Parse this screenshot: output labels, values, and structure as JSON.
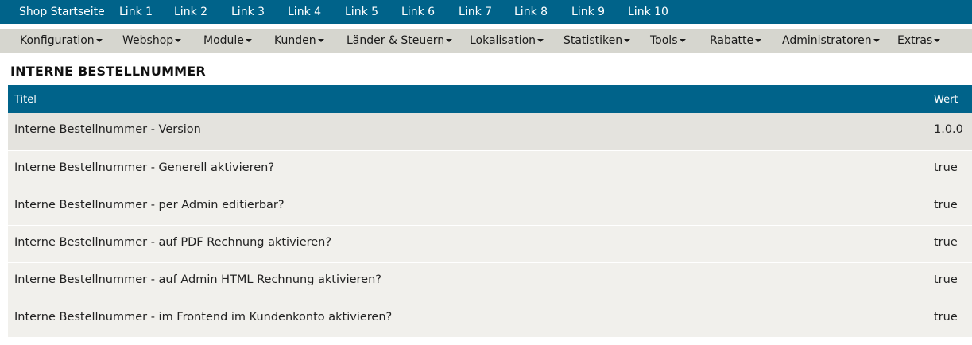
{
  "topnav": {
    "links": [
      "Shop Startseite",
      "Link 1",
      "Link 2",
      "Link 3",
      "Link 4",
      "Link 5",
      "Link 6",
      "Link 7",
      "Link 8",
      "Link 9",
      "Link 10"
    ]
  },
  "menu": {
    "items": [
      "Konfiguration",
      "Webshop",
      "Module",
      "Kunden",
      "Länder & Steuern",
      "Lokalisation",
      "Statistiken",
      "Tools",
      "Rabatte",
      "Administratoren",
      "Extras"
    ]
  },
  "page": {
    "title": "INTERNE BESTELLNUMMER"
  },
  "table": {
    "headers": {
      "title": "Titel",
      "value": "Wert"
    },
    "rows": [
      {
        "title": "Interne Bestellnummer - Version",
        "value": "1.0.0"
      },
      {
        "title": "Interne Bestellnummer - Generell aktivieren?",
        "value": "true"
      },
      {
        "title": "Interne Bestellnummer - per Admin editierbar?",
        "value": "true"
      },
      {
        "title": "Interne Bestellnummer - auf PDF Rechnung aktivieren?",
        "value": "true"
      },
      {
        "title": "Interne Bestellnummer - auf Admin HTML Rechnung aktivieren?",
        "value": "true"
      },
      {
        "title": "Interne Bestellnummer - im Frontend im Kundenkonto aktivieren?",
        "value": "true"
      }
    ]
  },
  "colors": {
    "header_bar": "#00638a",
    "menu_bar": "#d6d6cf",
    "row_selected": "#e4e3de",
    "row_default": "#f1f0ec"
  }
}
